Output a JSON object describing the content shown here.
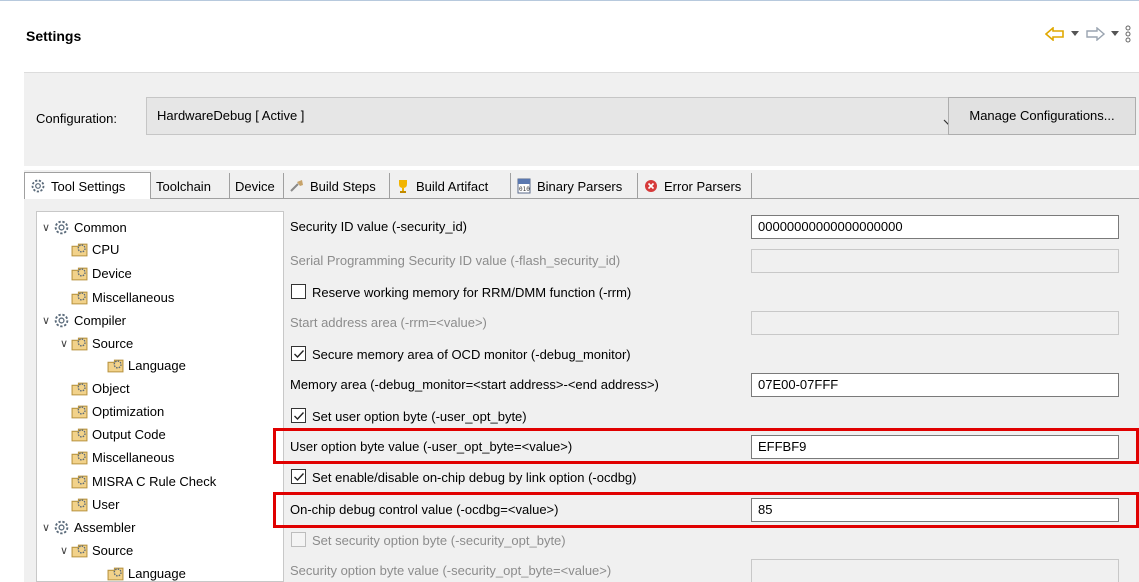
{
  "header": {
    "title": "Settings"
  },
  "configuration": {
    "label": "Configuration:",
    "selected": "HardwareDebug  [ Active ]",
    "manage_button": "Manage Configurations..."
  },
  "tabs": [
    {
      "label": "Tool Settings",
      "icon": "gear-icon",
      "active": true
    },
    {
      "label": "Toolchain",
      "icon": "",
      "active": false
    },
    {
      "label": "Device",
      "icon": "",
      "active": false
    },
    {
      "label": "Build Steps",
      "icon": "build-steps-icon",
      "active": false
    },
    {
      "label": "Build Artifact",
      "icon": "trophy-icon",
      "active": false
    },
    {
      "label": "Binary Parsers",
      "icon": "binary-icon",
      "active": false
    },
    {
      "label": "Error Parsers",
      "icon": "error-icon",
      "active": false
    }
  ],
  "tree": [
    {
      "label": "Common",
      "expanded": true
    },
    {
      "label": "CPU"
    },
    {
      "label": "Device"
    },
    {
      "label": "Miscellaneous"
    },
    {
      "label": "Compiler",
      "expanded": true
    },
    {
      "label": "Source",
      "expanded": true
    },
    {
      "label": "Language"
    },
    {
      "label": "Object"
    },
    {
      "label": "Optimization"
    },
    {
      "label": "Output Code"
    },
    {
      "label": "Miscellaneous"
    },
    {
      "label": "MISRA C Rule Check"
    },
    {
      "label": "User"
    },
    {
      "label": "Assembler",
      "expanded": true
    },
    {
      "label": "Source",
      "expanded": true
    },
    {
      "label": "Language"
    }
  ],
  "props": {
    "security_id_label": "Security ID value (-security_id)",
    "security_id_value": "00000000000000000000",
    "flash_security_label": "Serial Programming Security ID value (-flash_security_id)",
    "flash_security_value": "",
    "rrm_label": "Reserve working memory for RRM/DMM function (-rrm)",
    "rrm_checked": false,
    "rrm_start_label": "Start address area (-rrm=<value>)",
    "rrm_start_value": "",
    "debug_monitor_label": "Secure memory area of OCD monitor (-debug_monitor)",
    "debug_monitor_checked": true,
    "memory_area_label": "Memory area (-debug_monitor=<start address>-<end address>)",
    "memory_area_value": "07E00-07FFF",
    "user_opt_label": "Set user option byte (-user_opt_byte)",
    "user_opt_checked": true,
    "user_opt_value_label": "User option byte value (-user_opt_byte=<value>)",
    "user_opt_value": "EFFBF9",
    "ocdbg_label": "Set enable/disable on-chip debug by link option (-ocdbg)",
    "ocdbg_checked": true,
    "ocdbg_value_label": "On-chip debug control value (-ocdbg=<value>)",
    "ocdbg_value": "85",
    "security_opt_label": "Set security option byte (-security_opt_byte)",
    "security_opt_checked": false,
    "security_opt_value_label": "Security option byte value (-security_opt_byte=<value>)",
    "security_opt_value": ""
  },
  "colors": {
    "highlight": "#e00000",
    "accent_arrow": "#f0b400"
  }
}
